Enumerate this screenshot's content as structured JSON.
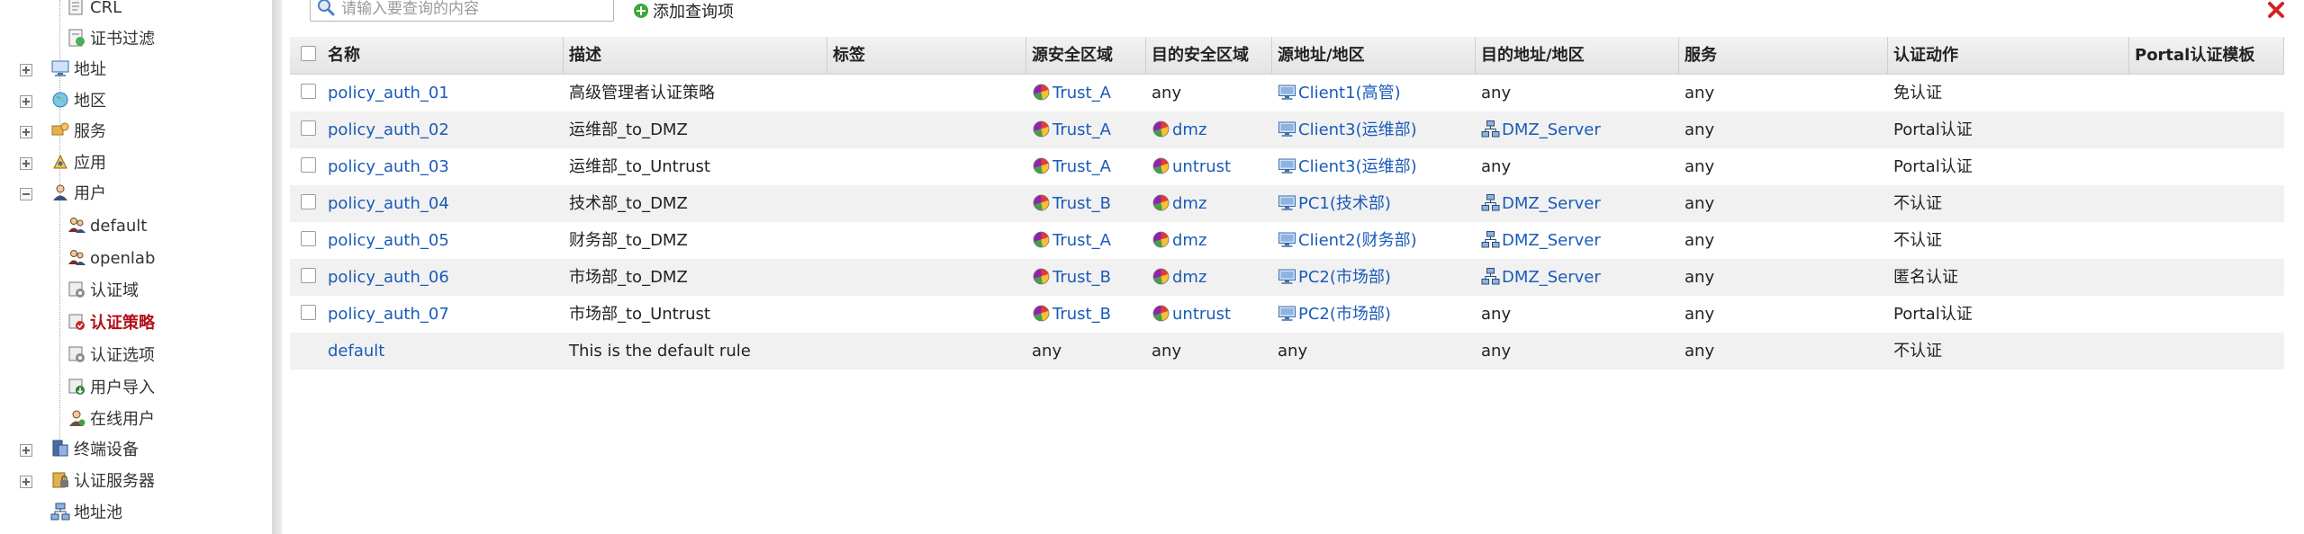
{
  "sidebar": {
    "items": [
      {
        "label": "CRL",
        "icon": "crl-icon"
      },
      {
        "label": "证书过滤",
        "icon": "cert-filter-icon"
      },
      {
        "label": "地址",
        "icon": "address-icon"
      },
      {
        "label": "地区",
        "icon": "region-icon"
      },
      {
        "label": "服务",
        "icon": "service-icon"
      },
      {
        "label": "应用",
        "icon": "application-icon"
      },
      {
        "label": "用户",
        "icon": "user-icon"
      },
      {
        "label": "default",
        "icon": "user-group-icon"
      },
      {
        "label": "openlab",
        "icon": "user-group-icon"
      },
      {
        "label": "认证域",
        "icon": "auth-domain-icon"
      },
      {
        "label": "认证策略",
        "icon": "auth-policy-icon"
      },
      {
        "label": "认证选项",
        "icon": "auth-option-icon"
      },
      {
        "label": "用户导入",
        "icon": "user-import-icon"
      },
      {
        "label": "在线用户",
        "icon": "online-user-icon"
      },
      {
        "label": "终端设备",
        "icon": "terminal-device-icon"
      },
      {
        "label": "认证服务器",
        "icon": "auth-server-icon"
      },
      {
        "label": "地址池",
        "icon": "address-pool-icon"
      }
    ]
  },
  "toolbar": {
    "search_placeholder": "请输入要查询的内容",
    "add_query_label": "添加查询项"
  },
  "table": {
    "columns": [
      "名称",
      "描述",
      "标签",
      "源安全区域",
      "目的安全区域",
      "源地址/地区",
      "目的地址/地区",
      "服务",
      "认证动作",
      "Portal认证模板"
    ],
    "rows": [
      {
        "name": "policy_auth_01",
        "desc": "高级管理者认证策略",
        "tag": "",
        "src_zone": "Trust_A",
        "dst_zone": "any",
        "src_addr": "Client1(高管)",
        "dst_addr": "any",
        "service": "any",
        "action": "免认证",
        "portal": ""
      },
      {
        "name": "policy_auth_02",
        "desc": "运维部_to_DMZ",
        "tag": "",
        "src_zone": "Trust_A",
        "dst_zone": "dmz",
        "src_addr": "Client3(运维部)",
        "dst_addr": "DMZ_Server",
        "service": "any",
        "action": "Portal认证",
        "portal": ""
      },
      {
        "name": "policy_auth_03",
        "desc": "运维部_to_Untrust",
        "tag": "",
        "src_zone": "Trust_A",
        "dst_zone": "untrust",
        "src_addr": "Client3(运维部)",
        "dst_addr": "any",
        "service": "any",
        "action": "Portal认证",
        "portal": ""
      },
      {
        "name": "policy_auth_04",
        "desc": "技术部_to_DMZ",
        "tag": "",
        "src_zone": "Trust_B",
        "dst_zone": "dmz",
        "src_addr": "PC1(技术部)",
        "dst_addr": "DMZ_Server",
        "service": "any",
        "action": "不认证",
        "portal": ""
      },
      {
        "name": "policy_auth_05",
        "desc": "财务部_to_DMZ",
        "tag": "",
        "src_zone": "Trust_A",
        "dst_zone": "dmz",
        "src_addr": "Client2(财务部)",
        "dst_addr": "DMZ_Server",
        "service": "any",
        "action": "不认证",
        "portal": ""
      },
      {
        "name": "policy_auth_06",
        "desc": "市场部_to_DMZ",
        "tag": "",
        "src_zone": "Trust_B",
        "dst_zone": "dmz",
        "src_addr": "PC2(市场部)",
        "dst_addr": "DMZ_Server",
        "service": "any",
        "action": "匿名认证",
        "portal": ""
      },
      {
        "name": "policy_auth_07",
        "desc": "市场部_to_Untrust",
        "tag": "",
        "src_zone": "Trust_B",
        "dst_zone": "untrust",
        "src_addr": "PC2(市场部)",
        "dst_addr": "any",
        "service": "any",
        "action": "Portal认证",
        "portal": ""
      },
      {
        "name": "default",
        "desc": "This is the default rule",
        "tag": "",
        "src_zone": "any",
        "dst_zone": "any",
        "src_addr": "any",
        "dst_addr": "any",
        "service": "any",
        "action": "不认证",
        "portal": ""
      }
    ]
  },
  "colors": {
    "link": "#1a5bb8",
    "active_nav": "#b0121b",
    "close": "#d42323",
    "add_icon": "#3aa83a"
  }
}
